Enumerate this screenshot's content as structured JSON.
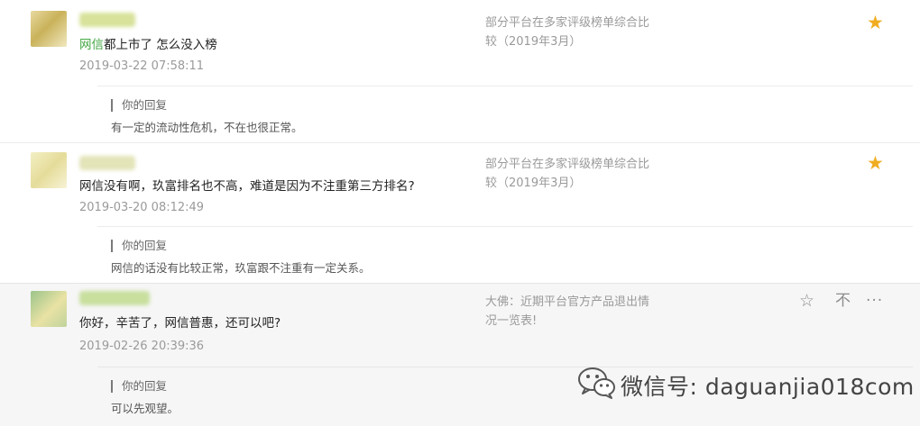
{
  "comments": [
    {
      "text_highlight": "网信",
      "text_rest": "都上市了 怎么没入榜",
      "time": "2019-03-22 07:58:11",
      "article_line1": "部分平台在多家评级榜单综合比",
      "article_line2": "较（2019年3月）",
      "starred": "★",
      "reply_label": "你的回复",
      "reply_text": "有一定的流动性危机，不在也很正常。"
    },
    {
      "text": "网信没有啊，玖富排名也不高，难道是因为不注重第三方排名?",
      "time": "2019-03-20 08:12:49",
      "article_line1": "部分平台在多家评级榜单综合比",
      "article_line2": "较（2019年3月）",
      "starred": "★",
      "reply_label": "你的回复",
      "reply_text": "网信的话没有比较正常，玖富跟不注重有一定关系。"
    },
    {
      "text": "你好，辛苦了，网信普惠，还可以吧?",
      "time": "2019-02-26 20:39:36",
      "article_line1": "大佛：近期平台官方产品退出情",
      "article_line2": "况一览表!",
      "actions": {
        "star": "☆",
        "down": "不",
        "more": "···"
      },
      "reply_label": "你的回复",
      "reply_text": "可以先观望。"
    }
  ],
  "watermark": {
    "text": "微信号: daguanjia018com",
    "icon": "wechat-icon"
  },
  "colors": {
    "highlight_green": "#44a744",
    "star_gold": "#f0ad22",
    "muted_gray": "#9a9a9a"
  }
}
